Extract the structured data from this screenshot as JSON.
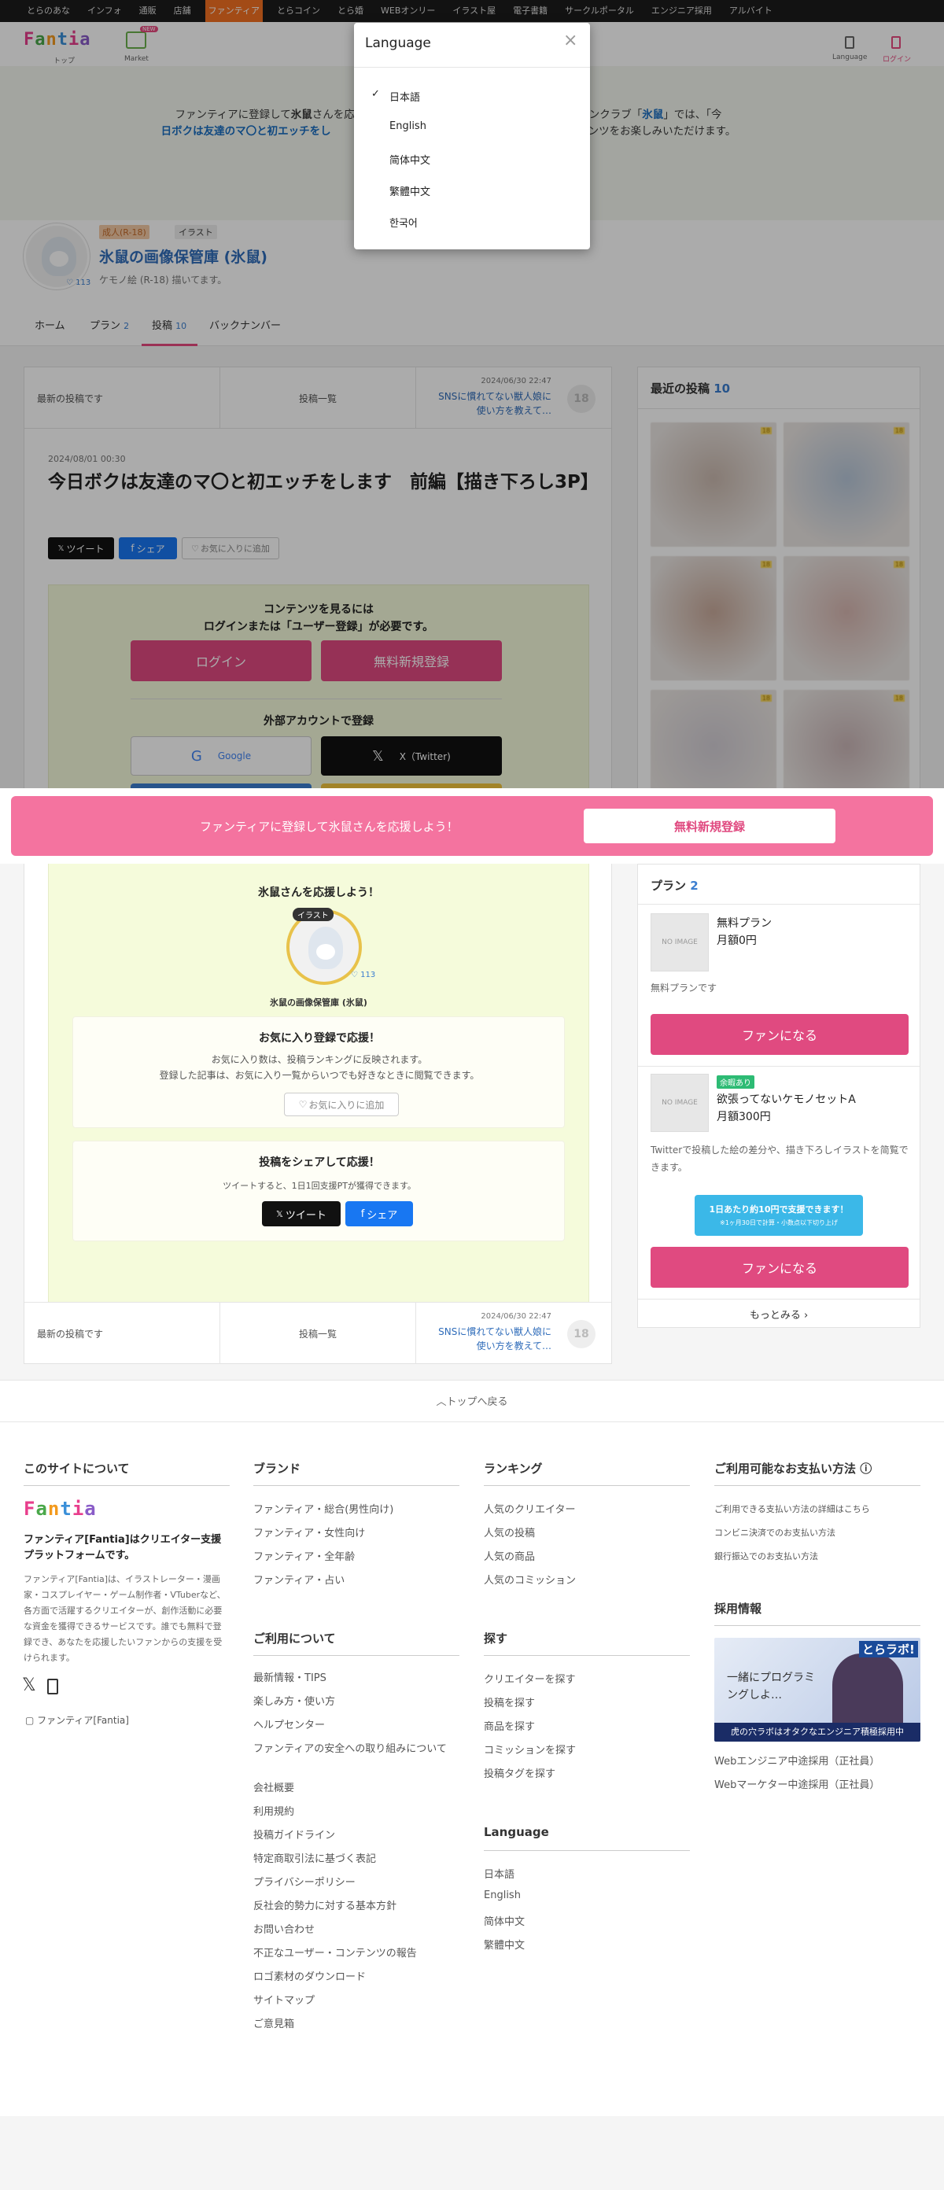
{
  "topnav": {
    "items": [
      "とらのあな",
      "インフォ",
      "通販",
      "店舗",
      "ファンティア",
      "とらコイン",
      "とら婚",
      "WEBオンリー",
      "イラスト屋",
      "電子書籍",
      "サークルポータル",
      "エンジニア採用",
      "アルバイト"
    ],
    "active_index": 4
  },
  "header": {
    "logo": "Fantia",
    "home_label": "トップ",
    "market_label": "Market",
    "new_badge": "NEW",
    "language_label": "Language",
    "login_label": "ログイン"
  },
  "banner": {
    "line1_pre": "ファンティアに登録して",
    "creator": "氷鼠",
    "line1_mid": "さんを応援し",
    "line1_post": "鼠さんのファンクラブ「",
    "club": "氷鼠",
    "line1_end": "」では、「今",
    "line2_post": "ンテンツをお楽しみいただけます。",
    "post_title_pre": "日ボクは友達のマ〇と初エッチをし"
  },
  "profile": {
    "tag_adult": "成人(R-18)",
    "tag_illust": "イラスト",
    "name": "氷鼠の画像保管庫 (氷鼠)",
    "desc": "ケモノ絵 (R-18) 描いてます。",
    "likes": "113"
  },
  "tabs": [
    {
      "label": "ホーム",
      "count": ""
    },
    {
      "label": "プラン",
      "count": "2"
    },
    {
      "label": "投稿",
      "count": "10"
    },
    {
      "label": "バックナンバー",
      "count": ""
    }
  ],
  "post_nav": {
    "latest": "最新の投稿です",
    "list": "投稿一覧",
    "next_date": "2024/06/30 22:47",
    "next_title": "SNSに慣れてない獣人娘に使い方を教えて…",
    "next_badge": "18"
  },
  "post": {
    "date": "2024/08/01 00:30",
    "title": "今日ボクは友達のマ〇と初エッチをします　前編【描き下ろし3P】",
    "tweet": "ツイート",
    "share": "シェア",
    "fav": "お気に入りに追加"
  },
  "login_box": {
    "line1": "コンテンツを見るには",
    "line2": "ログインまたは「ユーザー登録」が必要です。",
    "login_btn": "ログイン",
    "register_btn": "無料新規登録",
    "external": "外部アカウントで登録",
    "google": "Google",
    "x": "X（Twitter)"
  },
  "cta_bar": {
    "text": "ファンティアに登録して氷鼠さんを応援しよう！",
    "button": "無料新規登録"
  },
  "support": {
    "title": "氷鼠さんを応援しよう！",
    "tag": "イラスト",
    "likes": "113",
    "name": "氷鼠の画像保管庫 (氷鼠)",
    "fav_title": "お気に入り登録で応援！",
    "fav_desc1": "お気に入り数は、投稿ランキングに反映されます。",
    "fav_desc2": "登録した記事は、お気に入り一覧からいつでも好きなときに閲覧できます。",
    "fav_btn": "お気に入りに追加",
    "share_title": "投稿をシェアして応援！",
    "share_desc": "ツイートすると、1日1回支援PTが獲得できます。",
    "tweet": "ツイート",
    "share": "シェア"
  },
  "sidebar": {
    "recent_label": "最近の投稿",
    "recent_count": "10",
    "thumb_badge": "18",
    "plan_label": "プラン",
    "plan_count": "2",
    "noimage": "NO IMAGE",
    "plans": [
      {
        "name": "無料プラン",
        "price": "月額0円",
        "desc": "無料プランです",
        "button": "ファンになる",
        "badge": ""
      },
      {
        "name": "欲張ってないケモノセットA",
        "price": "月額300円",
        "desc": "Twitterで投稿した絵の差分や、描き下ろしイラストを简覧できます。",
        "button": "ファンになる",
        "badge": "余暇あり"
      }
    ],
    "bubble1": "1日あたり約10円で支援できます！",
    "bubble2": "※1ヶ月30日で計算・小数点以下切り上げ",
    "more": "もっとみる"
  },
  "to_top": "トップへ戻る",
  "language_modal": {
    "title": "Language",
    "options": [
      "日本語",
      "English",
      "简体中文",
      "繁體中文",
      "한국어"
    ],
    "selected_index": 0
  },
  "footer": {
    "about": {
      "title": "このサイトについて",
      "logo": "Fantia",
      "tagline": "ファンティア[Fantia]はクリエイター支援プラットフォームです。",
      "desc": "ファンティア[Fantia]は、イラストレーター・漫画家・コスプレイヤー・ゲーム制作者・VTuberなど、各方面で活躍するクリエイターが、創作活動に必要な資金を獲得できるサービスです。誰でも無料で登録でき、あなたを応援したいファンからの支援を受けられます。",
      "app": "ファンティア[Fantia]"
    },
    "brand": {
      "title": "ブランド",
      "items": [
        "ファンティア・総合(男性向け)",
        "ファンティア・女性向け",
        "ファンティア・全年齢",
        "ファンティア・占い"
      ]
    },
    "usage": {
      "title": "ご利用について",
      "items": [
        "最新情報・TIPS",
        "楽しみ方・使い方",
        "ヘルプセンター",
        "ファンティアの安全への取り組みについて",
        "会社概要",
        "利用規約",
        "投稿ガイドライン",
        "特定商取引法に基づく表記",
        "プライバシーポリシー",
        "反社会的勢力に対する基本方針",
        "お問い合わせ",
        "不正なユーザー・コンテンツの報告",
        "ロゴ素材のダウンロード",
        "サイトマップ",
        "ご意見箱"
      ]
    },
    "ranking": {
      "title": "ランキング",
      "items": [
        "人気のクリエイター",
        "人気の投稿",
        "人気の商品",
        "人気のコミッション"
      ]
    },
    "search": {
      "title": "探す",
      "items": [
        "クリエイターを探す",
        "投稿を探す",
        "商品を探す",
        "コミッションを探す",
        "投稿タグを探す"
      ]
    },
    "language": {
      "title": "Language",
      "items": [
        "日本語",
        "English",
        "简体中文",
        "繁體中文"
      ]
    },
    "payment": {
      "title": "ご利用可能なお支払い方法",
      "items": [
        "ご利用できる支払い方法の詳細はこちら",
        "コンビニ決済でのお支払い方法",
        "銀行振込でのお支払い方法"
      ]
    },
    "jobs": {
      "title": "採用情報",
      "banner_brand": "とらラボ!",
      "banner_text": "一緒にプログラミングしよ…",
      "banner_caption": "虎の穴ラボはオタクなエンジニア積極採用中",
      "items": [
        "Webエンジニア中途採用（正社員）",
        "Webマーケター中途採用（正社員）"
      ]
    }
  }
}
